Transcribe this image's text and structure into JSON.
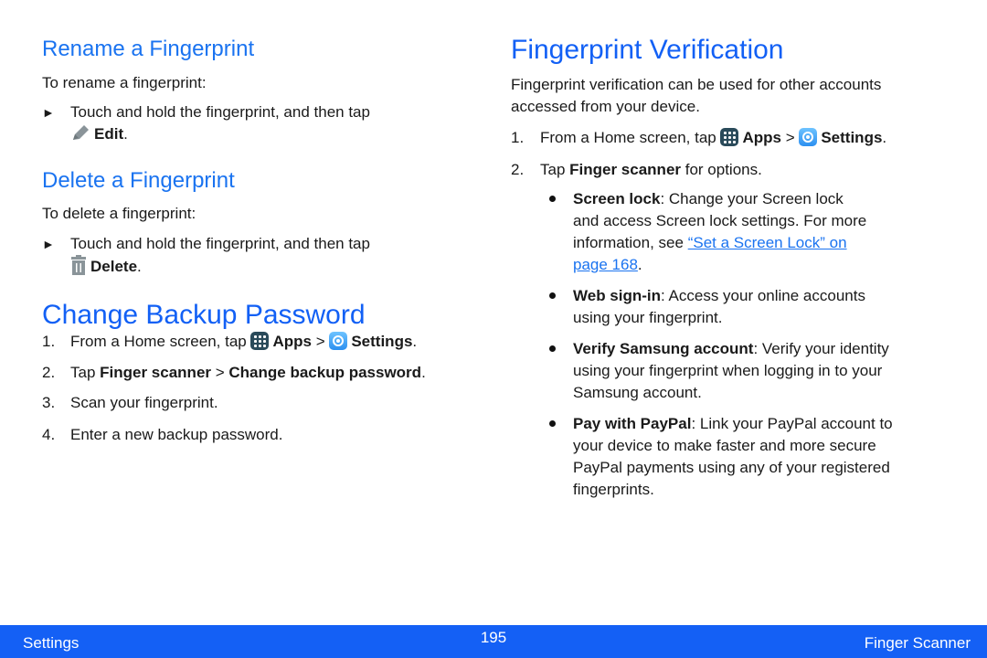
{
  "left": {
    "rename": {
      "heading": "Rename a Fingerprint",
      "intro": "To rename a fingerprint:",
      "step_text": "Touch and hold the fingerprint, and then tap",
      "step_action": "Edit",
      "step_end": ".",
      "icon": "pencil-icon"
    },
    "delete": {
      "heading": "Delete a Fingerprint",
      "intro": "To delete a fingerprint:",
      "step_text": "Touch and hold the fingerprint, and then tap",
      "step_action": "Delete",
      "step_end": ".",
      "icon": "trash-icon"
    },
    "backup": {
      "heading": "Change Backup Password",
      "steps": [
        {
          "num": "1.",
          "pre": "From a Home screen, tap ",
          "b1": "Apps",
          "sep": " > ",
          "b2": "Settings",
          "end": "."
        },
        {
          "num": "2.",
          "pre": "Tap ",
          "b1": "Finger scanner",
          "sep": " > ",
          "b2": "Change backup password",
          "end": "."
        },
        {
          "num": "3.",
          "text": "Scan your fingerprint."
        },
        {
          "num": "4.",
          "text": "Enter a new backup password."
        }
      ]
    }
  },
  "right": {
    "heading": "Fingerprint Verification",
    "intro_line1": "Fingerprint verification can be used for other accounts",
    "intro_line2": "accessed from your device.",
    "steps": [
      {
        "num": "1.",
        "pre": "From a Home screen, tap ",
        "b1": "Apps",
        "sep": " > ",
        "b2": "Settings",
        "end": "."
      },
      {
        "num": "2.",
        "pre": "Tap ",
        "b1": "Finger scanner",
        "end": " for options."
      }
    ],
    "bullets": [
      {
        "term": "Screen lock",
        "lines": [
          ": Change your Screen lock",
          "and access Screen lock settings. For more",
          "information, see "
        ],
        "link1": "“Set a Screen Lock” on ",
        "link2": "page 168",
        "end": "."
      },
      {
        "term": "Web sign-in",
        "lines": [
          ": Access your online accounts",
          "using your fingerprint."
        ]
      },
      {
        "term": "Verify Samsung account",
        "lines": [
          ": Verify your identity",
          "using your fingerprint when logging in to your",
          "Samsung account."
        ]
      },
      {
        "term": "Pay with PayPal",
        "lines": [
          ": Link your PayPal account to",
          "your device to make faster and more secure",
          "PayPal payments using any of your registered",
          "fingerprints."
        ]
      }
    ]
  },
  "footer": {
    "left": "Settings",
    "page_number": "195",
    "right": "Finger Scanner",
    "color": "#1460f5"
  }
}
